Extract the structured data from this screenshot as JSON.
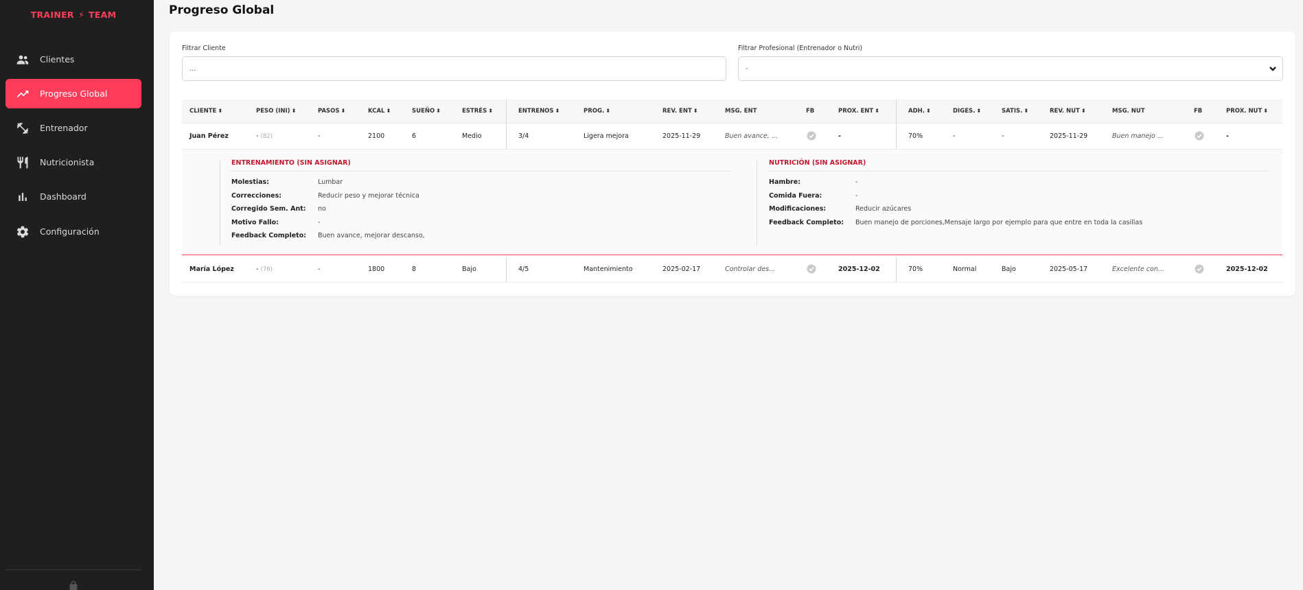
{
  "brand": {
    "left": "TRAINER",
    "bolt": "⚡",
    "right": "TEAM",
    "color": "#ff3d5a"
  },
  "sidebar": {
    "items": [
      {
        "label": "Clientes",
        "icon": "users-icon",
        "active": false
      },
      {
        "label": "Progreso Global",
        "icon": "trending-up-icon",
        "active": true
      },
      {
        "label": "Entrenador",
        "icon": "dumbbell-icon",
        "active": false
      },
      {
        "label": "Nutricionista",
        "icon": "utensils-icon",
        "active": false
      },
      {
        "label": "Dashboard",
        "icon": "bar-chart-icon",
        "active": false
      },
      {
        "label": "Configuración",
        "icon": "gear-icon",
        "active": false
      }
    ]
  },
  "page": {
    "title": "Progreso Global"
  },
  "filters": {
    "client_label": "Filtrar Cliente",
    "client_value": "...",
    "professional_label": "Filtrar Profesional (Entrenador o Nutri)",
    "professional_value": "-"
  },
  "table": {
    "headers": {
      "cliente": "CLIENTE",
      "peso": "PESO (INI)",
      "pasos": "PASOS",
      "kcal": "KCAL",
      "sueno": "SUEÑO",
      "estres": "ESTRÉS",
      "entrenos": "ENTRENOS",
      "prog": "PROG.",
      "rev_ent": "REV. ENT",
      "msg_ent": "MSG. ENT",
      "fb_ent": "FB",
      "prox_ent": "PROX. ENT",
      "adh": "ADH.",
      "diges": "DIGES.",
      "satis": "SATIS.",
      "rev_nut": "REV. NUT",
      "msg_nut": "MSG. NUT",
      "fb_nut": "FB",
      "prox_nut": "PROX. NUT",
      "sort_glyph": "⬍"
    },
    "rows": [
      {
        "cliente": "Juan Pérez",
        "peso": "-",
        "peso_ini": "(82)",
        "pasos": "-",
        "kcal": "2100",
        "sueno": "6",
        "estres": "Medio",
        "entrenos": "3/4",
        "prog": "Ligera mejora",
        "rev_ent": "2025-11-29",
        "msg_ent": "Buen avance, ...",
        "prox_ent": "-",
        "adh": "70%",
        "diges": "-",
        "satis": "-",
        "rev_nut": "2025-11-29",
        "msg_nut": "Buen manejo ...",
        "prox_nut": "-"
      },
      {
        "cliente": "María López",
        "peso": "-",
        "peso_ini": "(76)",
        "pasos": "-",
        "kcal": "1800",
        "sueno": "8",
        "estres": "Bajo",
        "entrenos": "4/5",
        "prog": "Mantenimiento",
        "rev_ent": "2025-02-17",
        "msg_ent": "Controlar des...",
        "prox_ent": "2025-12-02",
        "adh": "70%",
        "diges": "Normal",
        "satis": "Bajo",
        "rev_nut": "2025-05-17",
        "msg_nut": "Excelente con...",
        "prox_nut": "2025-12-02"
      }
    ],
    "detail": {
      "training": {
        "title": "ENTRENAMIENTO (SIN ASIGNAR)",
        "fields": [
          {
            "k": "Molestias:",
            "v": "Lumbar"
          },
          {
            "k": "Correcciones:",
            "v": "Reducir peso y mejorar técnica"
          },
          {
            "k": "Corregido Sem. Ant:",
            "v": "no"
          },
          {
            "k": "Motivo Fallo:",
            "v": "-"
          },
          {
            "k": "Feedback Completo:",
            "v": "Buen avance, mejorar descanso,"
          }
        ]
      },
      "nutrition": {
        "title": "NUTRICIÓN (SIN ASIGNAR)",
        "fields": [
          {
            "k": "Hambre:",
            "v": "-"
          },
          {
            "k": "Comida Fuera:",
            "v": "-"
          },
          {
            "k": "Modificaciones:",
            "v": "Reducir azúcares"
          },
          {
            "k": "Feedback Completo:",
            "v": "Buen manejo de porciones,Mensaje largo por ejemplo para que entre en toda la casillas"
          }
        ]
      }
    }
  }
}
